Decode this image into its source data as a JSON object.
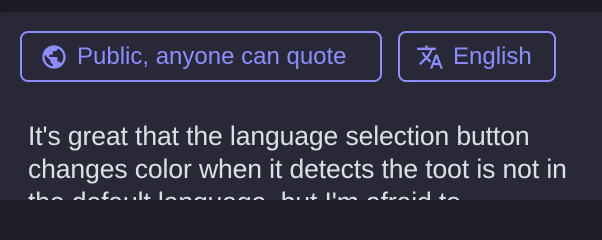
{
  "compose": {
    "visibility_button": {
      "label": "Public, anyone can quote",
      "icon": "globe-icon"
    },
    "language_button": {
      "label": "English",
      "icon": "translate-icon"
    },
    "toot_text": "It's great that the language selection button changes color when it detects the toot is not in the default language, but I'm afraid to"
  },
  "colors": {
    "accent": "#8c8dff",
    "panel_bg": "#292836",
    "page_bg": "#1f1f29",
    "text": "#d9e1e8"
  }
}
